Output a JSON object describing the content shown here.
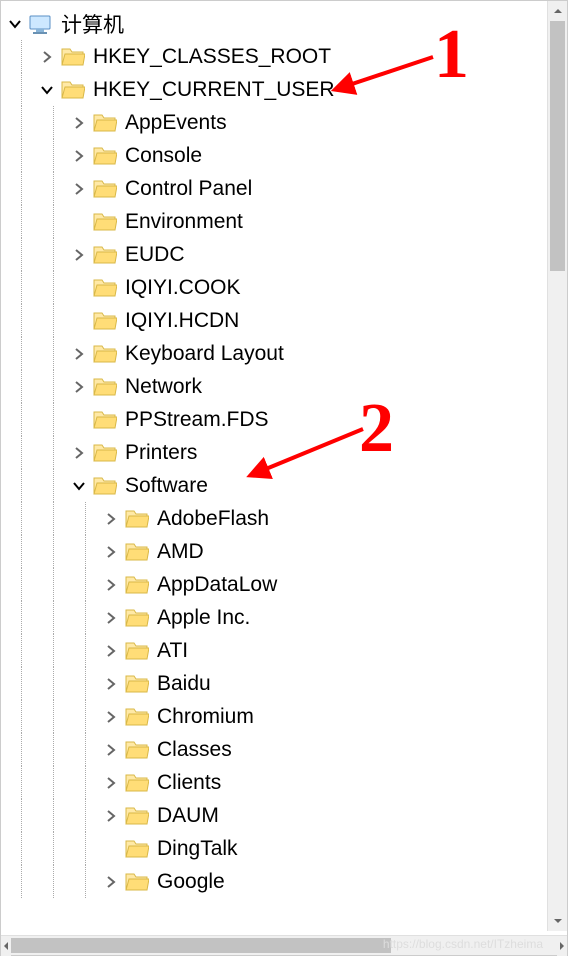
{
  "root_label": "计算机",
  "annotations": {
    "n1": "1",
    "n2": "2"
  },
  "watermark": "https://blog.csdn.net/ITzheima",
  "tree": [
    {
      "depth": 0,
      "toggle": "open",
      "icon": "computer",
      "bind": "root_label"
    },
    {
      "depth": 1,
      "toggle": "closed",
      "icon": "folder",
      "bind": "keys.0"
    },
    {
      "depth": 1,
      "toggle": "open",
      "icon": "folder",
      "bind": "keys.1"
    },
    {
      "depth": 2,
      "toggle": "closed",
      "icon": "folder",
      "bind": "hkcu.0"
    },
    {
      "depth": 2,
      "toggle": "closed",
      "icon": "folder",
      "bind": "hkcu.1"
    },
    {
      "depth": 2,
      "toggle": "closed",
      "icon": "folder",
      "bind": "hkcu.2"
    },
    {
      "depth": 2,
      "toggle": "none",
      "icon": "folder",
      "bind": "hkcu.3"
    },
    {
      "depth": 2,
      "toggle": "closed",
      "icon": "folder",
      "bind": "hkcu.4"
    },
    {
      "depth": 2,
      "toggle": "none",
      "icon": "folder",
      "bind": "hkcu.5"
    },
    {
      "depth": 2,
      "toggle": "none",
      "icon": "folder",
      "bind": "hkcu.6"
    },
    {
      "depth": 2,
      "toggle": "closed",
      "icon": "folder",
      "bind": "hkcu.7"
    },
    {
      "depth": 2,
      "toggle": "closed",
      "icon": "folder",
      "bind": "hkcu.8"
    },
    {
      "depth": 2,
      "toggle": "none",
      "icon": "folder",
      "bind": "hkcu.9"
    },
    {
      "depth": 2,
      "toggle": "closed",
      "icon": "folder",
      "bind": "hkcu.10"
    },
    {
      "depth": 2,
      "toggle": "open",
      "icon": "folder",
      "bind": "hkcu.11"
    },
    {
      "depth": 3,
      "toggle": "closed",
      "icon": "folder",
      "bind": "software.0"
    },
    {
      "depth": 3,
      "toggle": "closed",
      "icon": "folder",
      "bind": "software.1"
    },
    {
      "depth": 3,
      "toggle": "closed",
      "icon": "folder",
      "bind": "software.2"
    },
    {
      "depth": 3,
      "toggle": "closed",
      "icon": "folder",
      "bind": "software.3"
    },
    {
      "depth": 3,
      "toggle": "closed",
      "icon": "folder",
      "bind": "software.4"
    },
    {
      "depth": 3,
      "toggle": "closed",
      "icon": "folder",
      "bind": "software.5"
    },
    {
      "depth": 3,
      "toggle": "closed",
      "icon": "folder",
      "bind": "software.6"
    },
    {
      "depth": 3,
      "toggle": "closed",
      "icon": "folder",
      "bind": "software.7"
    },
    {
      "depth": 3,
      "toggle": "closed",
      "icon": "folder",
      "bind": "software.8"
    },
    {
      "depth": 3,
      "toggle": "closed",
      "icon": "folder",
      "bind": "software.9"
    },
    {
      "depth": 3,
      "toggle": "none",
      "icon": "folder",
      "bind": "software.10"
    },
    {
      "depth": 3,
      "toggle": "closed",
      "icon": "folder",
      "bind": "software.11"
    }
  ],
  "keys": [
    "HKEY_CLASSES_ROOT",
    "HKEY_CURRENT_USER"
  ],
  "hkcu": [
    "AppEvents",
    "Console",
    "Control Panel",
    "Environment",
    "EUDC",
    "IQIYI.COOK",
    "IQIYI.HCDN",
    "Keyboard Layout",
    "Network",
    "PPStream.FDS",
    "Printers",
    "Software"
  ],
  "software": [
    "AdobeFlash",
    "AMD",
    "AppDataLow",
    "Apple Inc.",
    "ATI",
    "Baidu",
    "Chromium",
    "Classes",
    "Clients",
    "DAUM",
    "DingTalk",
    "Google"
  ]
}
